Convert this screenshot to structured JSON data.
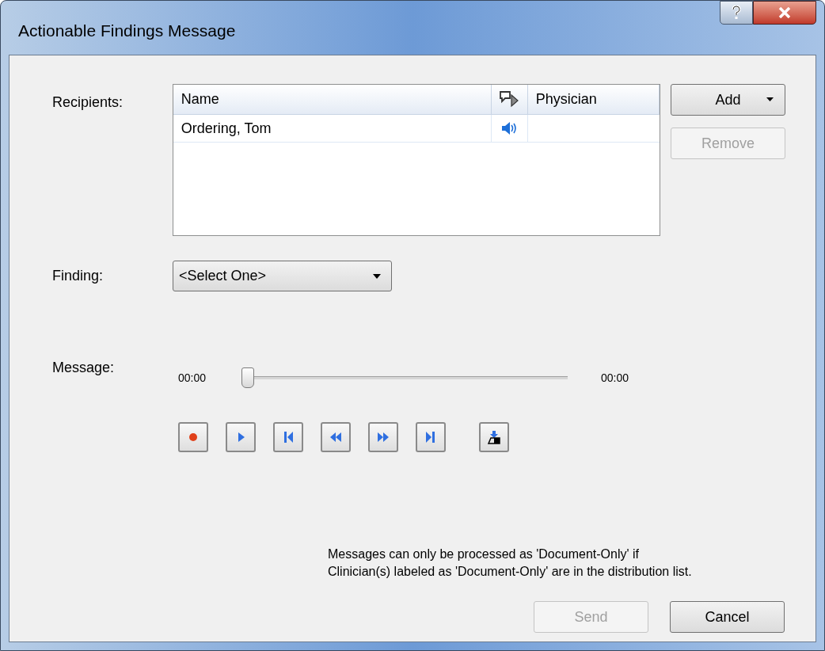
{
  "window": {
    "title": "Actionable Findings Message"
  },
  "recipients": {
    "label": "Recipients:",
    "columns": [
      {
        "kind": "text",
        "label": "Name"
      },
      {
        "kind": "icon"
      },
      {
        "kind": "text",
        "label": "Physician"
      }
    ],
    "rows": [
      {
        "name": "Ordering, Tom",
        "voice": true
      }
    ]
  },
  "add_button": {
    "label": "Add",
    "disabled": false
  },
  "remove_button": {
    "label": "Remove",
    "disabled": true
  },
  "finding": {
    "label": "Finding:",
    "value": "<Select One>"
  },
  "message": {
    "label": "Message:",
    "start_time": "00:00",
    "end_time": "00:00",
    "level": 0,
    "controls": [
      {
        "kind": "record"
      },
      {
        "kind": "play"
      },
      {
        "kind": "start"
      },
      {
        "kind": "rewind"
      },
      {
        "kind": "forward"
      },
      {
        "kind": "end"
      },
      {
        "kind": "import"
      }
    ]
  },
  "note": "Messages can only be processed as 'Document-Only' if\nClinician(s) labeled as 'Document-Only' are in the distribution list.",
  "send_button": {
    "label": "Send",
    "disabled": true
  },
  "cancel_button": {
    "label": "Cancel",
    "disabled": false
  }
}
